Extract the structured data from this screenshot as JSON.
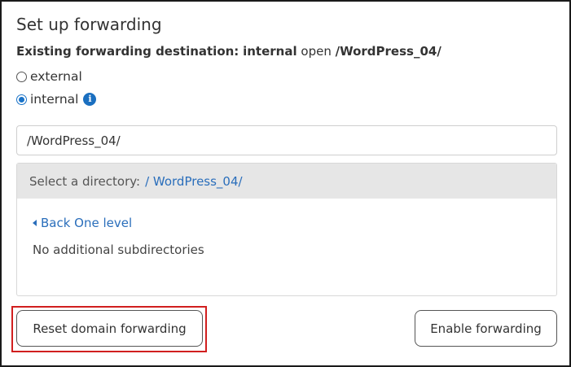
{
  "title": "Set up forwarding",
  "existing": {
    "prefix": "Existing forwarding destination:",
    "type": "internal",
    "action": "open",
    "path": "/WordPress_04/"
  },
  "options": {
    "external_label": "external",
    "internal_label": "internal",
    "selected": "internal"
  },
  "path_input": {
    "value": "/WordPress_04/"
  },
  "directory": {
    "header_label": "Select a directory:",
    "current_path": "/ WordPress_04/",
    "back_link": "Back One level",
    "empty_message": "No additional subdirectories"
  },
  "buttons": {
    "reset": "Reset domain forwarding",
    "enable": "Enable forwarding"
  },
  "colors": {
    "link": "#2a6ebb",
    "highlight": "#d11f1f",
    "info_icon": "#1a6fc0"
  }
}
